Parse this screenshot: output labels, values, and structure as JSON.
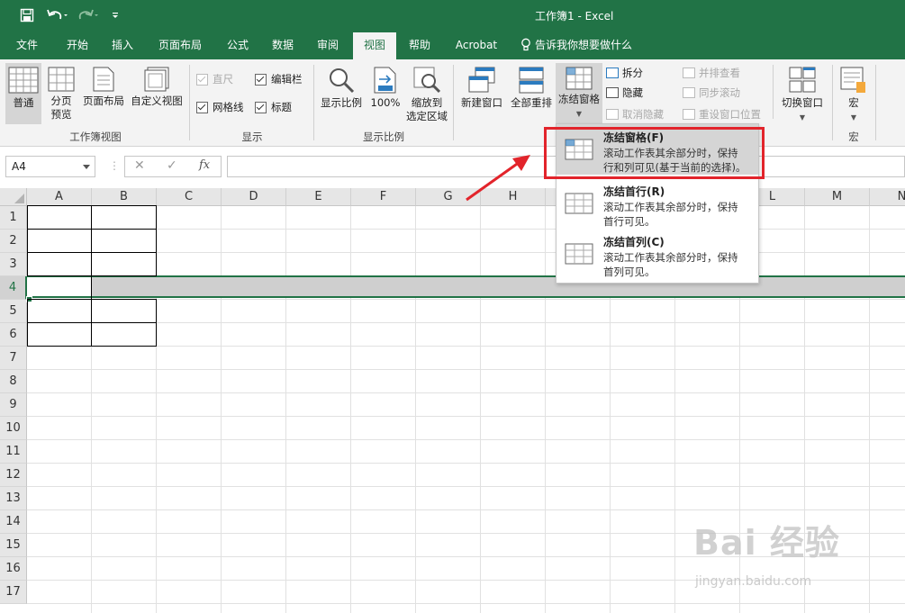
{
  "window": {
    "title": "工作簿1  -  Excel"
  },
  "tabs": [
    {
      "label": "文件"
    },
    {
      "label": "开始"
    },
    {
      "label": "插入"
    },
    {
      "label": "页面布局"
    },
    {
      "label": "公式"
    },
    {
      "label": "数据"
    },
    {
      "label": "审阅"
    },
    {
      "label": "视图"
    },
    {
      "label": "帮助"
    },
    {
      "label": "Acrobat"
    }
  ],
  "tellme": "告诉我你想要做什么",
  "ribbon": {
    "workbook_views": {
      "group": "工作簿视图",
      "normal": "普通",
      "page_break_1": "分页",
      "page_break_2": "预览",
      "page_layout": "页面布局",
      "custom_views": "自定义视图"
    },
    "show": {
      "group": "显示",
      "ruler": "直尺",
      "formula_bar": "编辑栏",
      "gridlines": "网格线",
      "headings": "标题"
    },
    "zoom": {
      "group": "显示比例",
      "zoom": "显示比例",
      "zoom100": "100%",
      "zoom_sel_1": "缩放到",
      "zoom_sel_2": "选定区域"
    },
    "window": {
      "new_window": "新建窗口",
      "arrange_all": "全部重排",
      "freeze_panes": "冻结窗格",
      "split": "拆分",
      "hide": "隐藏",
      "unhide": "取消隐藏",
      "side_by_side": "并排查看",
      "sync_scroll": "同步滚动",
      "reset_pos": "重设窗口位置",
      "switch_windows": "切换窗口"
    },
    "macros": {
      "group": "宏",
      "macros": "宏"
    }
  },
  "formula_bar": {
    "name_box": "A4",
    "fx": "fx",
    "value": ""
  },
  "grid": {
    "columns": [
      "A",
      "B",
      "C",
      "D",
      "E",
      "F",
      "G",
      "H",
      "I",
      "J",
      "K",
      "L",
      "M",
      "N"
    ],
    "rows": [
      "1",
      "2",
      "3",
      "4",
      "5",
      "6",
      "7",
      "8",
      "9",
      "10",
      "11",
      "12",
      "13",
      "14",
      "15",
      "16",
      "17"
    ],
    "selected_row": "4",
    "active_cell": "A4"
  },
  "freeze_menu": [
    {
      "title": "冻结窗格(F)",
      "desc1": "滚动工作表其余部分时，保持",
      "desc2": "行和列可见(基于当前的选择)。",
      "highlighted": true
    },
    {
      "title": "冻结首行(R)",
      "desc1": "滚动工作表其余部分时，保持",
      "desc2": "首行可见。",
      "highlighted": false
    },
    {
      "title": "冻结首列(C)",
      "desc1": "滚动工作表其余部分时，保持",
      "desc2": "首列可见。",
      "highlighted": false
    }
  ],
  "watermark": {
    "title": "Bai 经验",
    "url": "jingyan.baidu.com"
  },
  "colors": {
    "accent": "#217346",
    "highlight_box": "#e2242b"
  }
}
